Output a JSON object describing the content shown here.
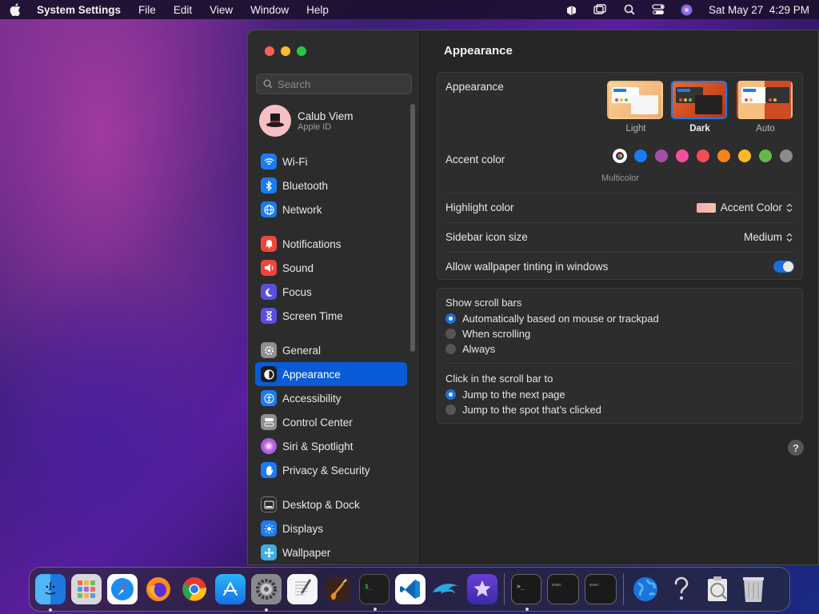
{
  "menubar": {
    "app_name": "System Settings",
    "menus": [
      "File",
      "Edit",
      "View",
      "Window",
      "Help"
    ],
    "clock": "Sat May 27  4:29 PM"
  },
  "sidebar": {
    "search_placeholder": "Search",
    "account": {
      "name": "Calub Viem",
      "subtitle": "Apple ID"
    },
    "groups": [
      [
        {
          "label": "Wi-Fi",
          "icon": "wifi-icon",
          "color": "#1a7cf5"
        },
        {
          "label": "Bluetooth",
          "icon": "bluetooth-icon",
          "color": "#1a7cf5"
        },
        {
          "label": "Network",
          "icon": "globe-icon",
          "color": "#1a7cf5"
        }
      ],
      [
        {
          "label": "Notifications",
          "icon": "bell-icon",
          "color": "#f0453a"
        },
        {
          "label": "Sound",
          "icon": "speaker-icon",
          "color": "#f0453a"
        },
        {
          "label": "Focus",
          "icon": "moon-icon",
          "color": "#5b4fe0"
        },
        {
          "label": "Screen Time",
          "icon": "hourglass-icon",
          "color": "#5b4fe0"
        }
      ],
      [
        {
          "label": "General",
          "icon": "gear-icon",
          "color": "#8e8e93"
        },
        {
          "label": "Appearance",
          "icon": "appearance-icon",
          "color": "#1c1c1e",
          "active": true
        },
        {
          "label": "Accessibility",
          "icon": "accessibility-icon",
          "color": "#1a7cf5"
        },
        {
          "label": "Control Center",
          "icon": "control-center-icon",
          "color": "#8e8e93"
        },
        {
          "label": "Siri & Spotlight",
          "icon": "siri-icon",
          "color": "#b04fd0"
        },
        {
          "label": "Privacy & Security",
          "icon": "hand-icon",
          "color": "#1a7cf5"
        }
      ],
      [
        {
          "label": "Desktop & Dock",
          "icon": "dock-icon",
          "color": "#2a2a2a"
        },
        {
          "label": "Displays",
          "icon": "sun-icon",
          "color": "#1a7cf5"
        },
        {
          "label": "Wallpaper",
          "icon": "wallpaper-icon",
          "color": "#38b0e8"
        }
      ]
    ]
  },
  "main": {
    "title": "Appearance",
    "appearance": {
      "label": "Appearance",
      "options": [
        {
          "label": "Light",
          "selected": false
        },
        {
          "label": "Dark",
          "selected": true
        },
        {
          "label": "Auto",
          "selected": false
        }
      ]
    },
    "accent": {
      "label": "Accent color",
      "caption": "Multicolor",
      "colors": [
        "multicolor",
        "#1a7cf5",
        "#a550a7",
        "#f74f9e",
        "#f64c55",
        "#f7821b",
        "#fcb827",
        "#62ba46",
        "#8c8c8c"
      ]
    },
    "highlight": {
      "label": "Highlight color",
      "value": "Accent Color"
    },
    "sidebar_icon_size": {
      "label": "Sidebar icon size",
      "value": "Medium"
    },
    "wallpaper_tinting": {
      "label": "Allow wallpaper tinting in windows",
      "on": true
    },
    "scroll_bars": {
      "label": "Show scroll bars",
      "options": [
        {
          "label": "Automatically based on mouse or trackpad",
          "selected": true
        },
        {
          "label": "When scrolling",
          "selected": false
        },
        {
          "label": "Always",
          "selected": false
        }
      ]
    },
    "click_scroll": {
      "label": "Click in the scroll bar to",
      "options": [
        {
          "label": "Jump to the next page",
          "selected": true
        },
        {
          "label": "Jump to the spot that’s clicked",
          "selected": false
        }
      ]
    },
    "help": "?"
  },
  "dock": {
    "apps": [
      {
        "name": "finder",
        "running": true
      },
      {
        "name": "launchpad",
        "running": false
      },
      {
        "name": "safari",
        "running": false
      },
      {
        "name": "firefox",
        "running": false
      },
      {
        "name": "chrome",
        "running": false
      },
      {
        "name": "app-store",
        "running": false
      },
      {
        "name": "system-settings",
        "running": true
      },
      {
        "name": "textedit",
        "running": false
      },
      {
        "name": "garageband",
        "running": false
      },
      {
        "name": "terminal-app",
        "running": true
      },
      {
        "name": "vscode",
        "running": false
      },
      {
        "name": "dolphin",
        "running": false
      },
      {
        "name": "imovie-star",
        "running": false
      }
    ],
    "recents": [
      {
        "name": "terminal",
        "running": true
      },
      {
        "name": "exec-1",
        "running": false
      },
      {
        "name": "exec-2",
        "running": false
      }
    ],
    "utilities": [
      "network-globe",
      "help-question",
      "preview-viewer",
      "trash"
    ]
  }
}
